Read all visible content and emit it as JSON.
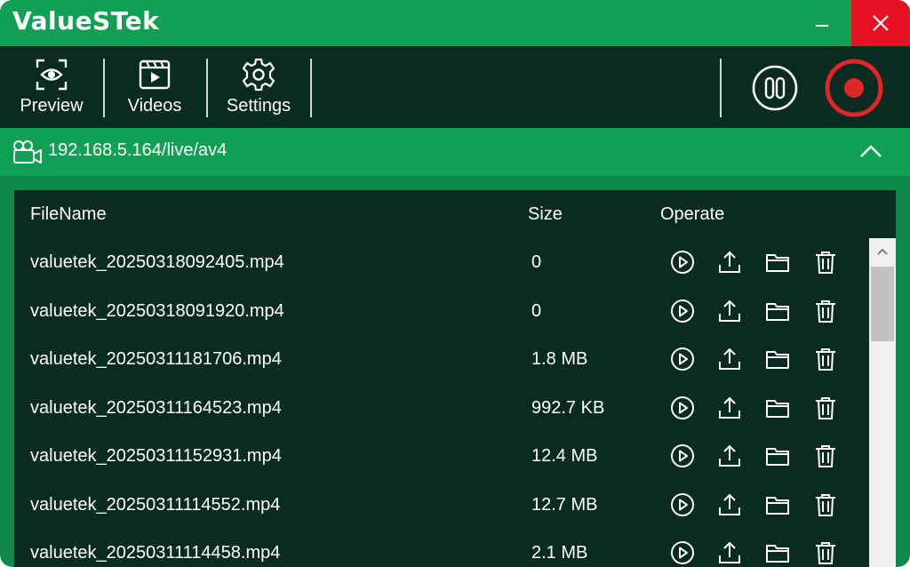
{
  "app": {
    "logo": "ValueSTek",
    "colors": {
      "accent": "#12a054",
      "dark": "#0a2b22",
      "record": "#e02626",
      "close": "#e81123"
    }
  },
  "titlebar": {
    "minimize_icon": "minimize-icon",
    "close_icon": "close-icon"
  },
  "toolbar": {
    "preview_label": "Preview",
    "videos_label": "Videos",
    "settings_label": "Settings",
    "pause_icon": "pause-icon",
    "record_icon": "record-icon"
  },
  "stream": {
    "url": "192.168.5.164/live/av4",
    "camera_icon": "camera-icon",
    "collapse_icon": "chevron-up-icon"
  },
  "table": {
    "headers": {
      "filename": "FileName",
      "size": "Size",
      "operate": "Operate"
    },
    "rows": [
      {
        "name": "valuetek_20250318092405.mp4",
        "size": "0"
      },
      {
        "name": "valuetek_20250318091920.mp4",
        "size": "0"
      },
      {
        "name": "valuetek_20250311181706.mp4",
        "size": "1.8 MB"
      },
      {
        "name": "valuetek_20250311164523.mp4",
        "size": "992.7 KB"
      },
      {
        "name": "valuetek_20250311152931.mp4",
        "size": "12.4 MB"
      },
      {
        "name": "valuetek_20250311114552.mp4",
        "size": "12.7 MB"
      },
      {
        "name": "valuetek_20250311114458.mp4",
        "size": "2.1 MB"
      }
    ],
    "operation_icons": [
      "play-icon",
      "upload-icon",
      "folder-icon",
      "delete-icon"
    ]
  }
}
